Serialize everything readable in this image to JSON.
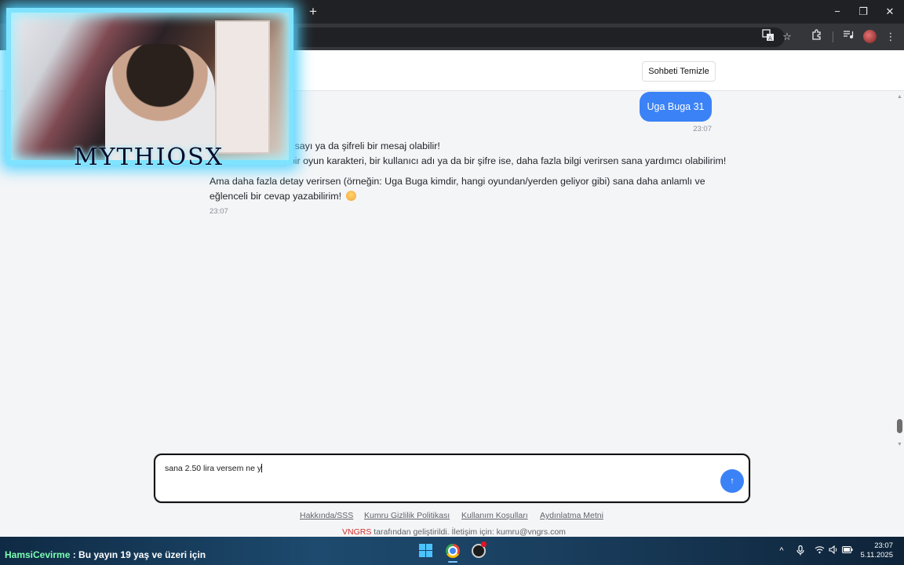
{
  "window_controls": {
    "new_tab": "+",
    "minimize": "−",
    "restore": "❐",
    "close": "✕"
  },
  "toolbar": {
    "translate_icon": "translate-icon",
    "bookmark_icon": "star-icon",
    "extensions_icon": "puzzle-icon",
    "media_icon": "media-queue-icon",
    "menu": "⋮"
  },
  "header": {
    "clear_button": "Sohbeti Temizle"
  },
  "chat": {
    "user_message": {
      "text": "Uga Buga 31",
      "time": "23:07"
    },
    "bot_message": {
      "lines": [
        "r sayı ya da şifreli bir mesaj olabilir!",
        ", bir oyun karakteri, bir kullanıcı adı ya da bir şifre ise, daha fazla bilgi verirsen sana yardımcı olabilirim!",
        "Ama daha fazla detay verirsen (örneğin: Uga Buga kimdir, hangi oyundan/yerden geliyor gibi) sana daha anlamlı ve",
        "eğlenceli bir cevap yazabilirim!"
      ],
      "emoji": "smiling-face-emoji",
      "time": "23:07"
    }
  },
  "composer": {
    "value": "sana 2.50 lira versem ne y",
    "send_label": "↑"
  },
  "footer": {
    "links": [
      "Hakkında/SSS",
      "Kumru Gizlilik Politikası",
      "Kullanım Koşulları",
      "Aydınlatma Metni"
    ],
    "brand": "VNGRS",
    "note": " tarafından geliştirildi. İletişim için: kumru@vngrs.com"
  },
  "stream_overlay": {
    "logo_text": "MYTHIOSX",
    "ticker_name": "HamsiCevirme",
    "ticker_text": " : Bu yayın 19 yaş ve üzeri için"
  },
  "taskbar": {
    "apps": [
      "windows-start-icon",
      "chrome-icon",
      "obs-icon"
    ],
    "tray": {
      "chevron": "^",
      "time": "23:07",
      "date": "5.11.2025"
    }
  },
  "colors": {
    "accent": "#3b82f6",
    "brand_red": "#d22f27",
    "overlay_glow": "#4fd2ff"
  }
}
